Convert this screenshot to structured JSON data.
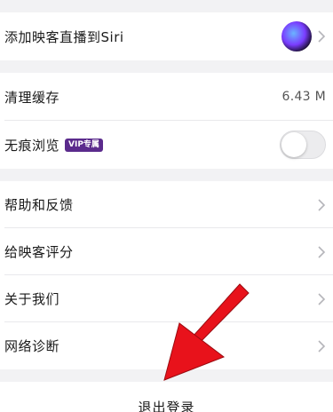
{
  "siri_row": {
    "label": "添加映客直播到Siri",
    "icon": "siri-icon"
  },
  "cache_row": {
    "label": "清理缓存",
    "value": "6.43 M"
  },
  "incognito_row": {
    "label": "无痕浏览",
    "badge": "VIP专属",
    "toggle_on": false
  },
  "menu": [
    {
      "key": "help",
      "label": "帮助和反馈"
    },
    {
      "key": "rate",
      "label": "给映客评分"
    },
    {
      "key": "about",
      "label": "关于我们"
    },
    {
      "key": "network",
      "label": "网络诊断"
    }
  ],
  "logout_label": "退出登录",
  "colors": {
    "vip_badge": "#5b2b8c",
    "arrow": "#e8121b",
    "background": "#f2f2f4"
  }
}
